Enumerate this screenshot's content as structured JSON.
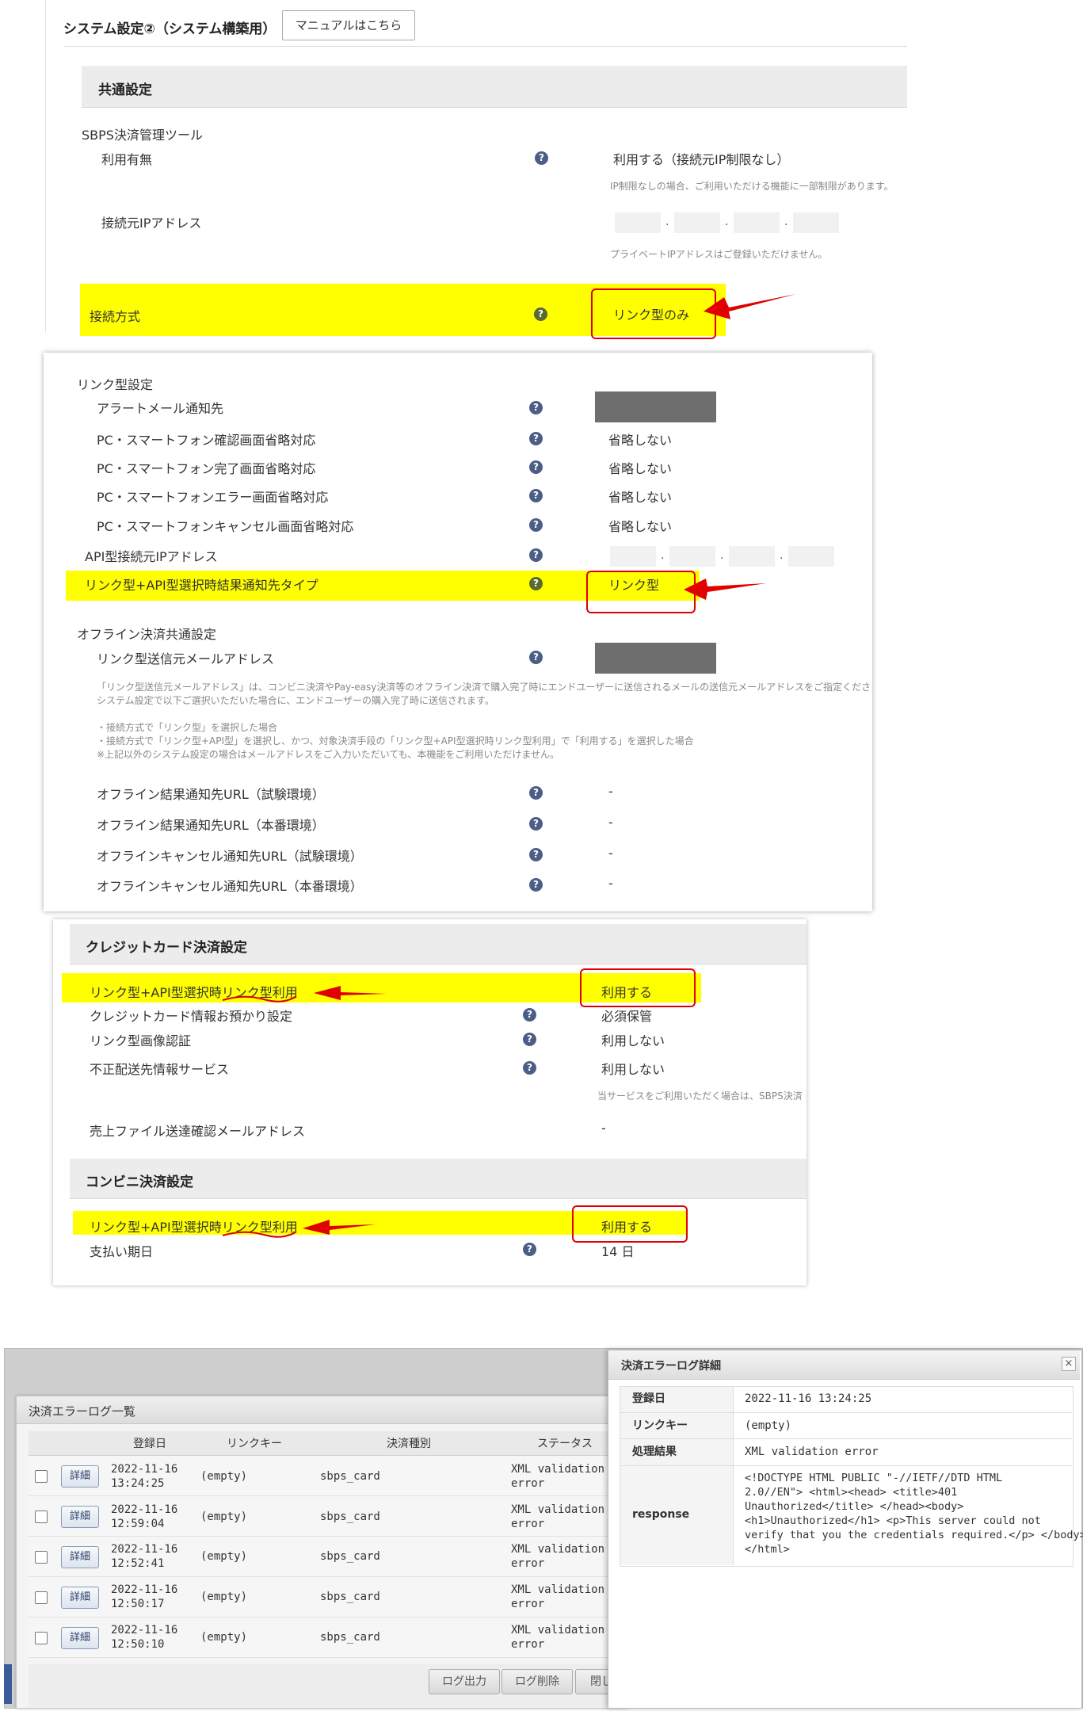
{
  "header": {
    "title": "システム設定②（システム構築用）",
    "manual_button": "マニュアルはこちら"
  },
  "common": {
    "section_title": "共通設定",
    "sbps_tool": "SBPS決済管理ツール",
    "usage_label": "利用有無",
    "usage_value": "利用する（接続元IP制限なし）",
    "usage_note": "IP制限なしの場合、ご利用いただける機能に一部制限があります。",
    "ip_label": "接続元IPアドレス",
    "ip_note": "プライベートIPアドレスはご登録いただけません。",
    "conn_label": "接続方式",
    "conn_value": "リンク型のみ"
  },
  "link": {
    "section_title": "リンク型設定",
    "alert_mail": "アラートメール通知先",
    "rows": [
      {
        "label": "PC・スマートフォン確認画面省略対応",
        "value": "省略しない"
      },
      {
        "label": "PC・スマートフォン完了画面省略対応",
        "value": "省略しない"
      },
      {
        "label": "PC・スマートフォンエラー画面省略対応",
        "value": "省略しない"
      },
      {
        "label": "PC・スマートフォンキャンセル画面省略対応",
        "value": "省略しない"
      }
    ],
    "api_ip_label": "API型接続元IPアドレス",
    "result_type_label": "リンク型+API型選択時結果通知先タイプ",
    "result_type_value": "リンク型",
    "offline_title": "オフライン決済共通設定",
    "sender_label": "リンク型送信元メールアドレス",
    "note_lines": [
      "「リンク型送信元メールアドレス」は、コンビニ決済やPay-easy決済等のオフライン決済で購入完了時にエンドユーザーに送信されるメールの送信元メールアドレスをご指定くださ",
      "システム設定で以下ご選択いただいた場合に、エンドユーザーの購入完了時に送信されます。",
      "",
      "・接続方式で「リンク型」を選択した場合",
      "・接続方式で「リンク型+API型」を選択し、かつ、対象決済手段の「リンク型+API型選択時リンク型利用」で「利用する」を選択した場合",
      "※上記以外のシステム設定の場合はメールアドレスをご入力いただいても、本機能をご利用いただけません。"
    ],
    "offline_rows": [
      {
        "label": "オフライン結果通知先URL（試験環境）",
        "value": "-"
      },
      {
        "label": "オフライン結果通知先URL（本番環境）",
        "value": "-"
      },
      {
        "label": "オフラインキャンセル通知先URL（試験環境）",
        "value": "-"
      },
      {
        "label": "オフラインキャンセル通知先URL（本番環境）",
        "value": "-"
      }
    ]
  },
  "credit": {
    "section_title": "クレジットカード決済設定",
    "link_use_label": "リンク型+API型選択時リンク型利用",
    "link_use_value": "利用する",
    "rows": [
      {
        "label": "クレジットカード情報お預かり設定",
        "value": "必須保管"
      },
      {
        "label": "リンク型画像認証",
        "value": "利用しない"
      },
      {
        "label": "不正配送先情報サービス",
        "value": "利用しない"
      }
    ],
    "service_note": "当サービスをご利用いただく場合は、SBPS決済",
    "sales_file_label": "売上ファイル送達確認メールアドレス",
    "sales_file_value": "-"
  },
  "cvs": {
    "section_title": "コンビニ決済設定",
    "link_use_label": "リンク型+API型選択時リンク型利用",
    "link_use_value": "利用する",
    "due_label": "支払い期日",
    "due_value": "14 日"
  },
  "log_list": {
    "title": "決済エラーログ一覧",
    "columns": [
      "登録日",
      "リンクキー",
      "決済種別",
      "ステータス"
    ],
    "detail_label": "詳細",
    "rows": [
      {
        "date": "2022-11-16",
        "time": "13:24:25",
        "key": "(empty)",
        "type": "sbps_card",
        "status1": "XML validation",
        "status2": "error"
      },
      {
        "date": "2022-11-16",
        "time": "12:59:04",
        "key": "(empty)",
        "type": "sbps_card",
        "status1": "XML validation",
        "status2": "error"
      },
      {
        "date": "2022-11-16",
        "time": "12:52:41",
        "key": "(empty)",
        "type": "sbps_card",
        "status1": "XML validation",
        "status2": "error"
      },
      {
        "date": "2022-11-16",
        "time": "12:50:17",
        "key": "(empty)",
        "type": "sbps_card",
        "status1": "XML validation",
        "status2": "error"
      },
      {
        "date": "2022-11-16",
        "time": "12:50:10",
        "key": "(empty)",
        "type": "sbps_card",
        "status1": "XML validation",
        "status2": "error"
      }
    ],
    "buttons": {
      "export": "ログ出力",
      "delete": "ログ削除",
      "close": "閉じ"
    }
  },
  "log_detail": {
    "title": "決済エラーログ詳細",
    "close_icon": "×",
    "rows": [
      {
        "label": "登録日",
        "value": "2022-11-16 13:24:25"
      },
      {
        "label": "リンクキー",
        "value": "(empty)"
      },
      {
        "label": "処理結果",
        "value": "XML validation error"
      }
    ],
    "response_label": "response",
    "response_lines": [
      "<!DOCTYPE HTML PUBLIC \"-//IETF//DTD HTML",
      "2.0//EN\"> <html><head> <title>401",
      "Unauthorized</title> </head><body>",
      "<h1>Unauthorized</h1> <p>This server could not",
      "verify that you the credentials required.</p> </body>",
      "</html>"
    ]
  },
  "colors": {
    "highlight": "#ffff00",
    "annotation": "#e00000",
    "help_icon": "#4b5f86"
  }
}
